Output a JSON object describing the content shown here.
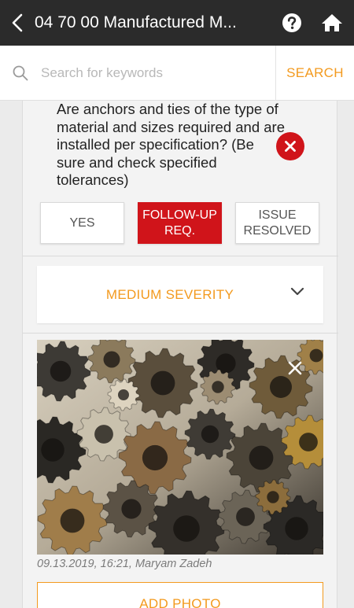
{
  "header": {
    "title": "04 70 00 Manufactured M...",
    "back_icon": "chevron-left-icon",
    "help_icon": "question-circle-icon",
    "home_icon": "home-icon"
  },
  "search": {
    "placeholder": "Search for keywords",
    "value": "",
    "button_label": "SEARCH"
  },
  "inspection_item": {
    "question": "Are anchors and ties of the type of material and sizes required and are installed per specification? (Be sure and check specified tolerances)",
    "status_icon": "error-x-icon",
    "options": [
      {
        "label": "YES",
        "selected": false
      },
      {
        "label": "FOLLOW-UP REQ.",
        "selected": true
      },
      {
        "label": "ISSUE RESOLVED",
        "selected": false
      }
    ],
    "severity": {
      "selected": "MEDIUM SEVERITY"
    },
    "photo": {
      "caption": "09.13.2019, 16:21, Maryam Zadeh"
    },
    "add_photo_label": "ADD PHOTO"
  },
  "colors": {
    "accent": "#f39a1e",
    "danger": "#d0141a",
    "topbar": "#2b2b2b"
  }
}
